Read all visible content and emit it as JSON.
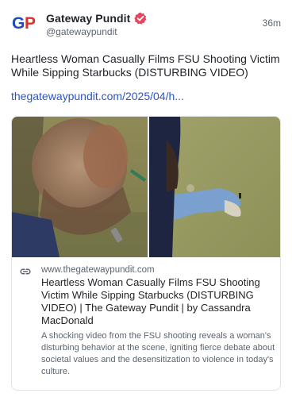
{
  "author": {
    "display_name": "Gateway Pundit",
    "handle": "@gatewaypundit",
    "avatar_text": "GP",
    "verified": true,
    "timestamp": "36m"
  },
  "post": {
    "text": "Heartless Woman Casually Films FSU Shooting Victim While Sipping Starbucks (DISTURBING VIDEO)",
    "link_text": "thegatewaypundit.com/2025/04/h..."
  },
  "link_card": {
    "domain": "www.thegatewaypundit.com",
    "title": "Heartless Woman Casually Films FSU Shooting Victim While Sipping Starbucks (DISTURBING VIDEO) | The Gateway Pundit | by Cassandra MacDonald",
    "description": "A shocking video from the FSU shooting reveals a woman's disturbing behavior at the scene, igniting fierce debate about societal values and the desensitization to violence in today's culture."
  },
  "colors": {
    "accent_link": "#2a55c7",
    "verified_badge": "#e2495f",
    "avatar_blue": "#1b4fb6",
    "avatar_red": "#d9312b"
  }
}
